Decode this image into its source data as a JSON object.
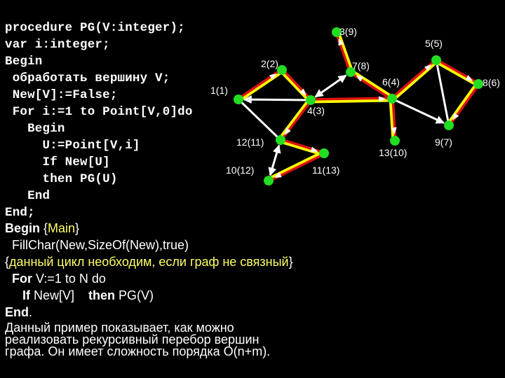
{
  "procedure_code": [
    "procedure PG(V:integer);",
    "var i:integer;",
    "Begin",
    " обработать вершину V;",
    " New[V]:=False;",
    " For i:=1 to Point[V,0]do",
    "   Begin",
    "     U:=Point[V,i]",
    "     If New[U]",
    "     then PG(U)",
    "   End",
    "End;"
  ],
  "main_block": {
    "begin_kw": "Begin ",
    "main_comment_open": "{",
    "main_comment_text": "Main",
    "main_comment_close": "}",
    "fillchar": "  FillChar(New,SizeOf(New),true)",
    "loop_comment_open": "{",
    "loop_comment_text": "данный цикл необходим, если граф не связный",
    "loop_comment_close": "}",
    "for_kw": "  For ",
    "for_rest": "V:=1 to N do",
    "if_kw": "     If ",
    "if_cond": "New[V]    ",
    "then_kw": "then ",
    "then_call": "PG(V)",
    "end_kw": "End",
    "end_dot": "."
  },
  "description": [
    "Данный пример показывает, как можно",
    "реализовать рекурсивный перебор вершин",
    "графа. Он имеет сложность порядка O(n+m)."
  ],
  "graph": {
    "colors": {
      "node": "#22dd22",
      "tree_edge_outer": "#ffff00",
      "tree_edge_inner": "#dd1111",
      "other_edge": "#ffffff",
      "comment": "#ffff66"
    },
    "nodes": [
      {
        "id": 1,
        "label": "1(1)"
      },
      {
        "id": 2,
        "label": "2(2)"
      },
      {
        "id": 3,
        "label": "3(9)"
      },
      {
        "id": 4,
        "label": "4(3)"
      },
      {
        "id": 5,
        "label": "5(5)"
      },
      {
        "id": 6,
        "label": "6(4)"
      },
      {
        "id": 7,
        "label": "7(8)"
      },
      {
        "id": 8,
        "label": "8(6)"
      },
      {
        "id": 9,
        "label": "9(7)"
      },
      {
        "id": 10,
        "label": "10(12)"
      },
      {
        "id": 11,
        "label": "11(13)"
      },
      {
        "id": 12,
        "label": "12(11)"
      },
      {
        "id": 13,
        "label": "13(10)"
      }
    ],
    "tree_edges": [
      [
        1,
        2
      ],
      [
        2,
        4
      ],
      [
        4,
        6
      ],
      [
        6,
        7
      ],
      [
        7,
        3
      ],
      [
        6,
        5
      ],
      [
        5,
        8
      ],
      [
        8,
        9
      ],
      [
        6,
        13
      ],
      [
        4,
        12
      ],
      [
        12,
        11
      ],
      [
        11,
        10
      ]
    ],
    "other_edges": [
      {
        "from": 4,
        "to": 1,
        "arrow": "end"
      },
      {
        "from": 12,
        "to": 1,
        "arrow": "none"
      },
      {
        "from": 4,
        "to": 7,
        "arrow": "both"
      },
      {
        "from": 5,
        "to": 9,
        "arrow": "none"
      },
      {
        "from": 6,
        "to": 9,
        "arrow": "end"
      },
      {
        "from": 12,
        "to": 10,
        "arrow": "both"
      }
    ]
  }
}
